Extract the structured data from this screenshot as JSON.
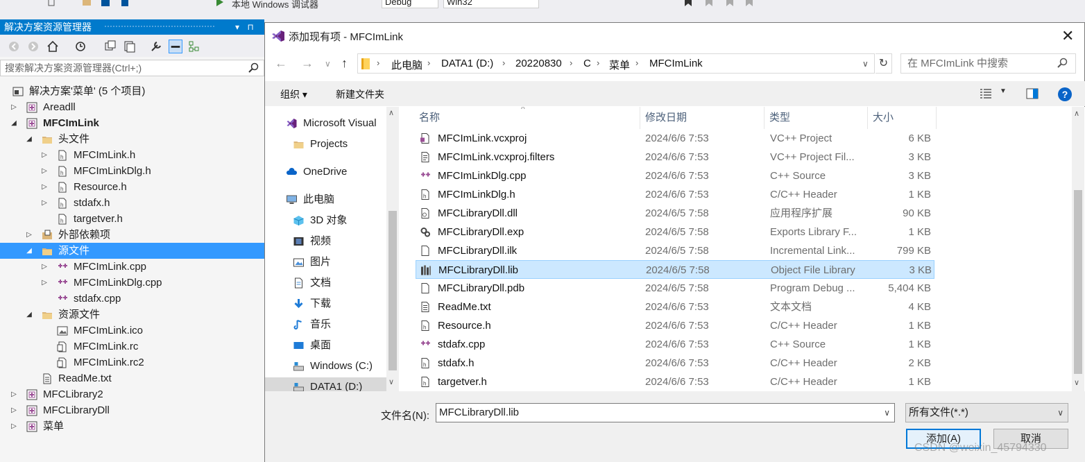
{
  "vs_toolbar": {
    "debugger_label": "本地 Windows 调试器",
    "config": "Debug",
    "platform": "Win32"
  },
  "solution_explorer": {
    "title": "解决方案资源管理器",
    "pin_glyph": "▾ ⊓ ✕",
    "search_placeholder": "搜索解决方案资源管理器(Ctrl+;)",
    "tree": [
      {
        "label": "解决方案'菜单' (5 个项目)",
        "depth": 0,
        "arrow": "",
        "icon": "solution-icon",
        "bold": false
      },
      {
        "label": "Areadll",
        "depth": 1,
        "arrow": "▷",
        "icon": "project-icon",
        "bold": false
      },
      {
        "label": "MFCImLink",
        "depth": 1,
        "arrow": "◢",
        "icon": "project-icon",
        "bold": true
      },
      {
        "label": "头文件",
        "depth": 2,
        "arrow": "◢",
        "icon": "folder-icon",
        "bold": false
      },
      {
        "label": "MFCImLink.h",
        "depth": 3,
        "arrow": "▷",
        "icon": "header-file-icon",
        "bold": false
      },
      {
        "label": "MFCImLinkDlg.h",
        "depth": 3,
        "arrow": "▷",
        "icon": "header-file-icon",
        "bold": false
      },
      {
        "label": "Resource.h",
        "depth": 3,
        "arrow": "▷",
        "icon": "header-file-icon",
        "bold": false
      },
      {
        "label": "stdafx.h",
        "depth": 3,
        "arrow": "▷",
        "icon": "header-file-icon",
        "bold": false
      },
      {
        "label": "targetver.h",
        "depth": 3,
        "arrow": "",
        "icon": "header-file-icon",
        "bold": false
      },
      {
        "label": "外部依赖项",
        "depth": 2,
        "arrow": "▷",
        "icon": "dependencies-icon",
        "bold": false
      },
      {
        "label": "源文件",
        "depth": 2,
        "arrow": "◢",
        "icon": "folder-icon",
        "bold": false,
        "selected": true
      },
      {
        "label": "MFCImLink.cpp",
        "depth": 3,
        "arrow": "▷",
        "icon": "cpp-file-icon",
        "bold": false
      },
      {
        "label": "MFCImLinkDlg.cpp",
        "depth": 3,
        "arrow": "▷",
        "icon": "cpp-file-icon",
        "bold": false
      },
      {
        "label": "stdafx.cpp",
        "depth": 3,
        "arrow": "",
        "icon": "cpp-file-icon",
        "bold": false
      },
      {
        "label": "资源文件",
        "depth": 2,
        "arrow": "◢",
        "icon": "folder-icon",
        "bold": false
      },
      {
        "label": "MFCImLink.ico",
        "depth": 3,
        "arrow": "",
        "icon": "image-file-icon",
        "bold": false
      },
      {
        "label": "MFCImLink.rc",
        "depth": 3,
        "arrow": "",
        "icon": "resource-file-icon",
        "bold": false
      },
      {
        "label": "MFCImLink.rc2",
        "depth": 3,
        "arrow": "",
        "icon": "resource-file-icon",
        "bold": false
      },
      {
        "label": "ReadMe.txt",
        "depth": 2,
        "arrow": "",
        "icon": "text-file-icon",
        "bold": false
      },
      {
        "label": "MFCLibrary2",
        "depth": 1,
        "arrow": "▷",
        "icon": "project-icon",
        "bold": false
      },
      {
        "label": "MFCLibraryDll",
        "depth": 1,
        "arrow": "▷",
        "icon": "project-icon",
        "bold": false
      },
      {
        "label": "菜单",
        "depth": 1,
        "arrow": "▷",
        "icon": "project-icon",
        "bold": false
      }
    ]
  },
  "dialog": {
    "title": "添加现有项 - MFCImLink",
    "close_glyph": "✕",
    "breadcrumb": [
      "此电脑",
      "DATA1 (D:)",
      "20220830",
      "C",
      "菜单",
      "MFCImLink"
    ],
    "search_placeholder": "在 MFCImLink 中搜索",
    "organize_label": "组织 ▾",
    "new_folder_label": "新建文件夹",
    "nav_items": [
      {
        "label": "Microsoft Visual",
        "icon": "vs-logo-icon"
      },
      {
        "label": "Projects",
        "icon": "folder-icon"
      },
      {
        "label": "OneDrive",
        "icon": "cloud-icon"
      },
      {
        "label": "此电脑",
        "icon": "computer-icon"
      },
      {
        "label": "3D 对象",
        "icon": "3d-objects-icon"
      },
      {
        "label": "视频",
        "icon": "videos-icon"
      },
      {
        "label": "图片",
        "icon": "pictures-icon"
      },
      {
        "label": "文档",
        "icon": "documents-icon"
      },
      {
        "label": "下载",
        "icon": "downloads-icon"
      },
      {
        "label": "音乐",
        "icon": "music-icon"
      },
      {
        "label": "桌面",
        "icon": "desktop-icon"
      },
      {
        "label": "Windows (C:)",
        "icon": "drive-icon"
      },
      {
        "label": "DATA1 (D:)",
        "icon": "drive-icon"
      }
    ],
    "columns": {
      "name": "名称",
      "date": "修改日期",
      "type": "类型",
      "size": "大小"
    },
    "files": [
      {
        "name": "MFCImLink.vcxproj",
        "date": "2024/6/6 7:53",
        "type": "VC++ Project",
        "size": "6 KB",
        "icon": "vcxproj-icon"
      },
      {
        "name": "MFCImLink.vcxproj.filters",
        "date": "2024/6/6 7:53",
        "type": "VC++ Project Fil...",
        "size": "3 KB",
        "icon": "filters-icon"
      },
      {
        "name": "MFCImLinkDlg.cpp",
        "date": "2024/6/6 7:53",
        "type": "C++ Source",
        "size": "3 KB",
        "icon": "cpp-file-icon"
      },
      {
        "name": "MFCImLinkDlg.h",
        "date": "2024/6/6 7:53",
        "type": "C/C++ Header",
        "size": "1 KB",
        "icon": "header-file-icon"
      },
      {
        "name": "MFCLibraryDll.dll",
        "date": "2024/6/5 7:58",
        "type": "应用程序扩展",
        "size": "90 KB",
        "icon": "dll-icon"
      },
      {
        "name": "MFCLibraryDll.exp",
        "date": "2024/6/5 7:58",
        "type": "Exports Library F...",
        "size": "1 KB",
        "icon": "exp-icon"
      },
      {
        "name": "MFCLibraryDll.ilk",
        "date": "2024/6/5 7:58",
        "type": "Incremental Link...",
        "size": "799 KB",
        "icon": "generic-file-icon"
      },
      {
        "name": "MFCLibraryDll.lib",
        "date": "2024/6/5 7:58",
        "type": "Object File Library",
        "size": "3 KB",
        "icon": "lib-icon",
        "selected": true
      },
      {
        "name": "MFCLibraryDll.pdb",
        "date": "2024/6/5 7:58",
        "type": "Program Debug ...",
        "size": "5,404 KB",
        "icon": "generic-file-icon"
      },
      {
        "name": "ReadMe.txt",
        "date": "2024/6/6 7:53",
        "type": "文本文档",
        "size": "4 KB",
        "icon": "text-file-icon"
      },
      {
        "name": "Resource.h",
        "date": "2024/6/6 7:53",
        "type": "C/C++ Header",
        "size": "1 KB",
        "icon": "header-file-icon"
      },
      {
        "name": "stdafx.cpp",
        "date": "2024/6/6 7:53",
        "type": "C++ Source",
        "size": "1 KB",
        "icon": "cpp-file-icon"
      },
      {
        "name": "stdafx.h",
        "date": "2024/6/6 7:53",
        "type": "C/C++ Header",
        "size": "2 KB",
        "icon": "header-file-icon"
      },
      {
        "name": "targetver.h",
        "date": "2024/6/6 7:53",
        "type": "C/C++ Header",
        "size": "1 KB",
        "icon": "header-file-icon"
      }
    ],
    "filename_label": "文件名(N):",
    "filename_value": "MFCLibraryDll.lib",
    "filter_value": "所有文件(*.*)",
    "add_label": "添加(A)",
    "cancel_label": "取消"
  },
  "watermark": "CSDN @weixin_45794330",
  "colors": {
    "vs_blue": "#007acc",
    "selection_blue": "#3399ff",
    "list_selection": "#cce8ff"
  }
}
